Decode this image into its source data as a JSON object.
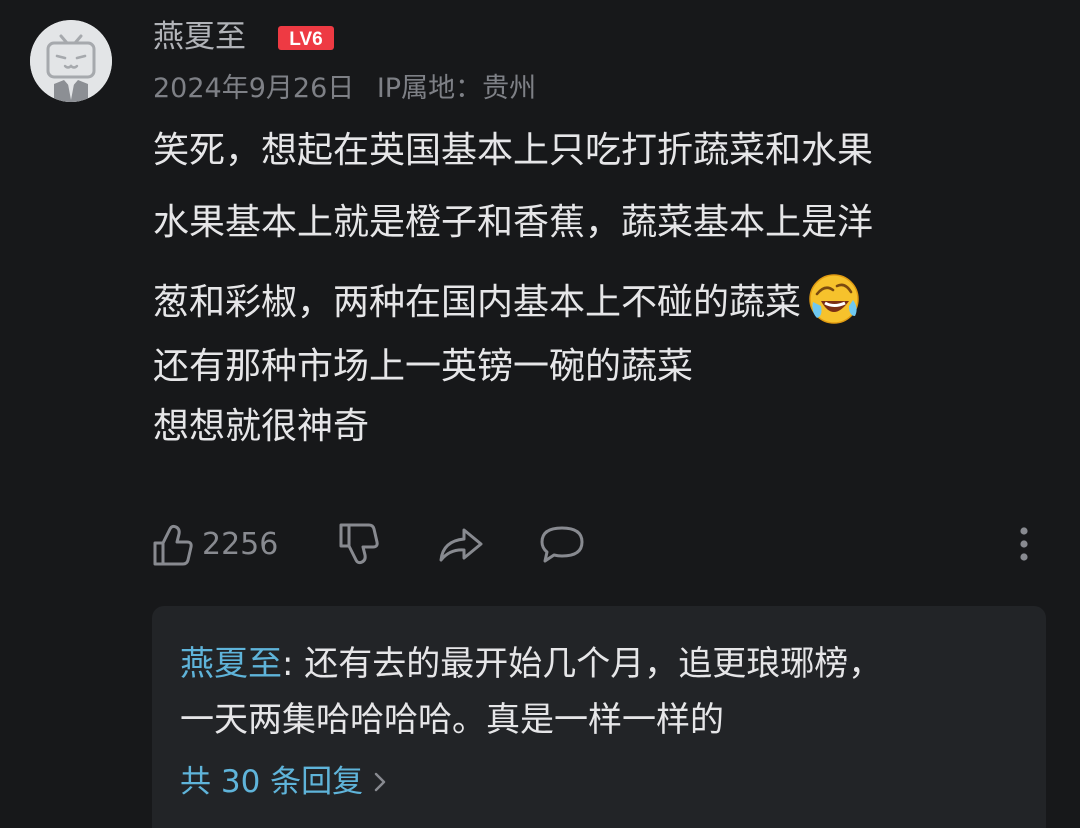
{
  "comment": {
    "username": "燕夏至",
    "level_badge": "LV6",
    "date": "2024年9月26日",
    "ip_location": "IP属地：贵州",
    "lines": [
      "笑死，想起在英国基本上只吃打折蔬菜和水果",
      "水果基本上就是橙子和香蕉，蔬菜基本上是洋",
      "葱和彩椒，两种在国内基本上不碰的蔬菜",
      "还有那种市场上一英镑一碗的蔬菜",
      "想想就很神奇"
    ],
    "emoji": "laughing-crying-emoji",
    "like_count": "2256"
  },
  "icons": {
    "avatar": "bilibili-tv-avatar-icon",
    "like": "thumbs-up-icon",
    "dislike": "thumbs-down-icon",
    "share": "share-arrow-icon",
    "comment": "comment-bubble-icon",
    "more": "more-vertical-icon",
    "chevron": "chevron-right-icon"
  },
  "colors": {
    "background": "#17181a",
    "reply_background": "#222427",
    "link": "#5fb4da",
    "level_badge": "#ee3a43"
  },
  "reply_preview": {
    "username": "燕夏至",
    "separator": ": ",
    "line1": "还有去的最开始几个月，追更琅琊榜，",
    "line2": "一天两集哈哈哈哈。真是一样一样的",
    "view_replies": "共 30 条回复"
  }
}
